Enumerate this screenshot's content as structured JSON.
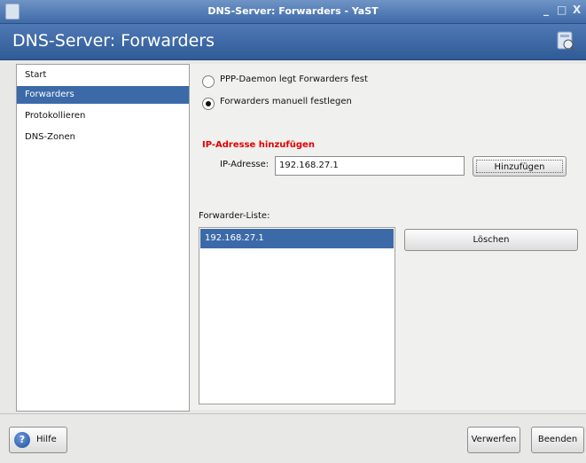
{
  "window": {
    "title": "DNS-Server: Forwarders - YaST",
    "minimize_glyph": "_",
    "maximize_glyph": "□",
    "close_glyph": "X"
  },
  "header": {
    "title": "DNS-Server: Forwarders",
    "icon": "yast-module-icon"
  },
  "sidebar": {
    "items": [
      {
        "label": "Start",
        "active": false
      },
      {
        "label": "Forwarders",
        "active": true
      },
      {
        "label": "Protokollieren",
        "active": false
      },
      {
        "label": "DNS-Zonen",
        "active": false
      }
    ]
  },
  "main": {
    "radio_ppp": {
      "label": "PPP-Daemon legt Forwarders fest",
      "checked": false
    },
    "radio_manual": {
      "label": "Forwarders manuell festlegen",
      "checked": true
    },
    "add_section_title": "IP-Adresse hinzufügen",
    "ip_label": "IP-Adresse:",
    "ip_value": "192.168.27.1",
    "add_button": "Hinzufügen",
    "list_label": "Forwarder-Liste:",
    "forwarders": [
      "192.168.27.1"
    ],
    "delete_button": "Löschen"
  },
  "footer": {
    "help_button": "Hilfe",
    "discard_button": "Verwerfen",
    "quit_button": "Beenden"
  },
  "colors": {
    "titlebar": "#4f79b5",
    "selection": "#3c6aa8",
    "section_title": "#e00000"
  }
}
